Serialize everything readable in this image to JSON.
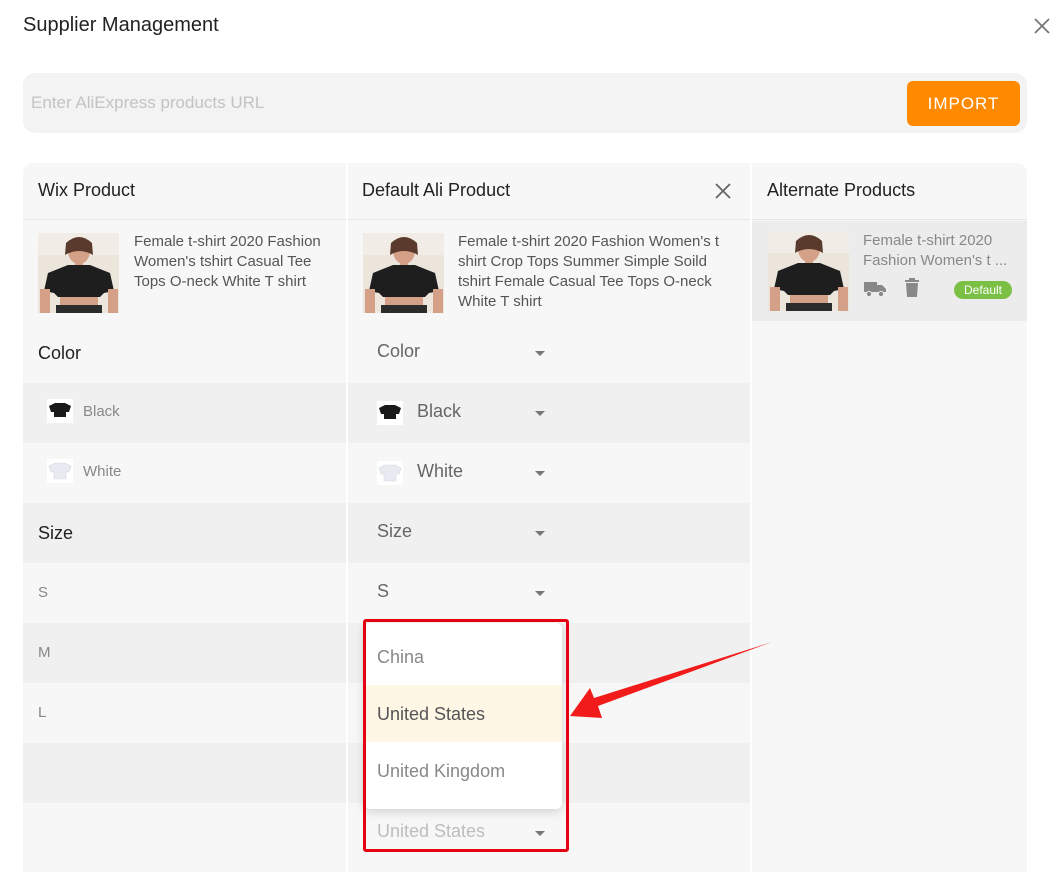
{
  "modal": {
    "title": "Supplier Management"
  },
  "import": {
    "placeholder": "Enter AliExpress products URL",
    "value": "",
    "button_label": "IMPORT"
  },
  "columns": {
    "wix": {
      "header": "Wix Product"
    },
    "ali": {
      "header": "Default Ali Product"
    },
    "alt": {
      "header": "Alternate Products"
    }
  },
  "wix_product": {
    "title": "Female t-shirt 2020 Fashion Women's tshirt Casual Tee Tops O-neck White T shirt"
  },
  "ali_product": {
    "title": "Female t-shirt 2020 Fashion Women's t shirt Crop Tops Summer Simple Soild tshirt Female Casual Tee Tops O-neck White T shirt"
  },
  "alternate_product": {
    "title": "Female t-shirt 2020 Fashion Women's t ...",
    "badge": "Default"
  },
  "variants": {
    "color_label": "Color",
    "colors": [
      {
        "wix": "Black",
        "ali": "Black",
        "swatch": "#1a1a1a"
      },
      {
        "wix": "White",
        "ali": "White",
        "swatch": "#eceef5"
      }
    ],
    "size_label": "Size",
    "sizes": [
      {
        "wix": "S",
        "ali": "S"
      },
      {
        "wix": "M",
        "ali": ""
      },
      {
        "wix": "L",
        "ali": ""
      }
    ],
    "ship_from_selected": "United States"
  },
  "selects": {
    "color_placeholder": "Color",
    "size_placeholder": "Size"
  },
  "dropdown": {
    "options": [
      "China",
      "United States",
      "United Kingdom"
    ],
    "selected_index": 1
  },
  "colors": {
    "accent": "#ff8a00",
    "badge": "#7cbf45",
    "highlight": "#e60012",
    "selected_bg": "#fff7e6"
  }
}
